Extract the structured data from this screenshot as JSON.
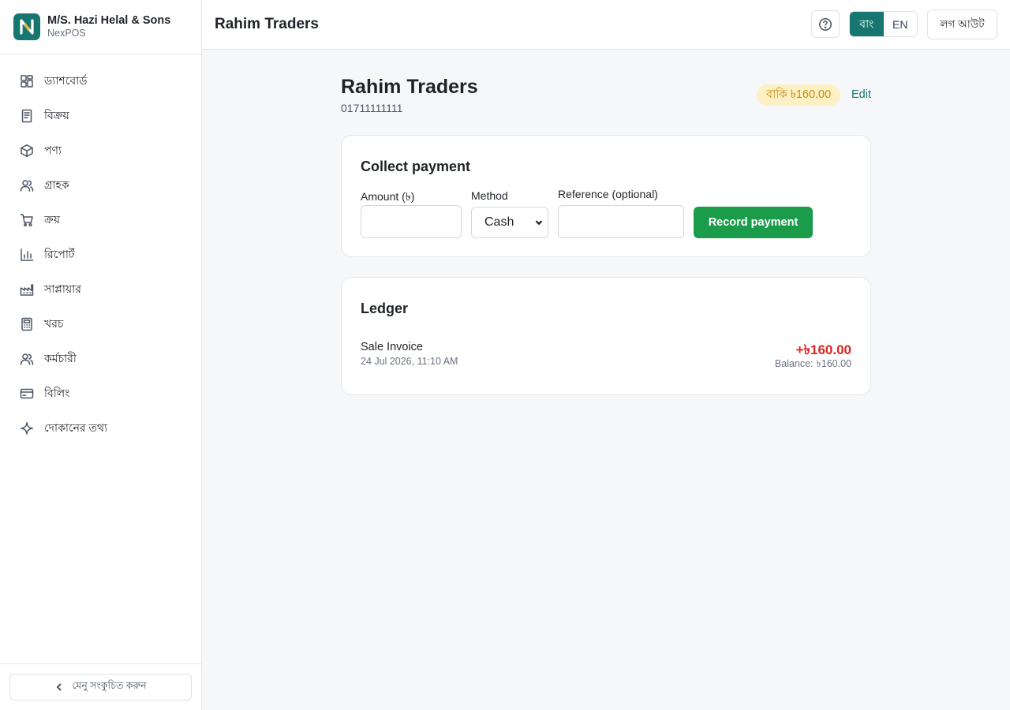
{
  "sidebar": {
    "brand_name": "M/S. Hazi Helal & Sons",
    "brand_sub": "NexPOS",
    "logo_letter": "N",
    "items": [
      {
        "label": "ড্যাশবোর্ড",
        "icon": "dashboard-icon"
      },
      {
        "label": "বিক্রয়",
        "icon": "receipt-icon"
      },
      {
        "label": "পণ্য",
        "icon": "box-icon"
      },
      {
        "label": "গ্রাহক",
        "icon": "users-icon"
      },
      {
        "label": "ক্রয়",
        "icon": "cart-icon"
      },
      {
        "label": "রিপোর্ট",
        "icon": "bar-chart-icon"
      },
      {
        "label": "সাপ্লায়ার",
        "icon": "factory-icon"
      },
      {
        "label": "খরচ",
        "icon": "calculator-icon"
      },
      {
        "label": "কর্মচারী",
        "icon": "staff-icon"
      },
      {
        "label": "বিলিং",
        "icon": "credit-card-icon"
      },
      {
        "label": "দোকানের তথ্য",
        "icon": "sparkle-icon"
      }
    ],
    "collapse_label": "মেনু সংকুচিত করুন"
  },
  "topbar": {
    "title": "Rahim Traders",
    "lang_bn": "বাং",
    "lang_en": "EN",
    "active_lang": "bn",
    "logout_label": "লগ আউট"
  },
  "customer": {
    "name": "Rahim Traders",
    "phone": "01711111111",
    "due_badge": "বাকি ৳160.00",
    "edit_label": "Edit"
  },
  "payment": {
    "title": "Collect payment",
    "amount_label": "Amount (৳)",
    "amount_value": "",
    "method_label": "Method",
    "method_value": "Cash",
    "reference_label": "Reference (optional)",
    "reference_value": "",
    "record_label": "Record payment"
  },
  "ledger": {
    "title": "Ledger",
    "entries": [
      {
        "title": "Sale Invoice",
        "date": "24 Jul 2026, 11:10 AM",
        "amount": "+৳160.00",
        "balance_label": "Balance:",
        "balance_value": "৳160.00"
      }
    ]
  },
  "colors": {
    "brand": "#17766f",
    "primary_button": "#1a9c4b",
    "due_badge_bg": "#fdf0c4",
    "due_badge_text": "#c98a07",
    "debit_amount": "#dc2626"
  }
}
